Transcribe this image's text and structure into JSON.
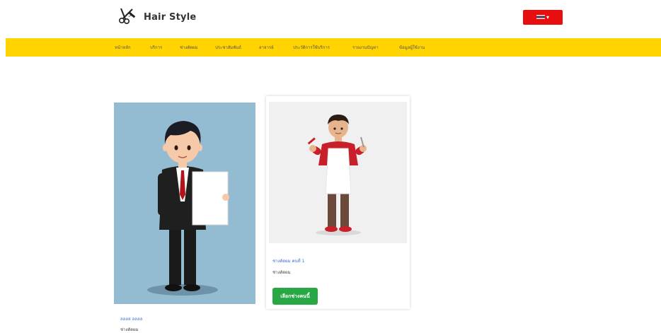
{
  "header": {
    "brand": "Hair Style",
    "logo_icon": "scissors-comb-icon",
    "lang_icon": "thai-flag-icon",
    "lang_color": "#e60e0e"
  },
  "nav": {
    "background": "#ffd400",
    "items": [
      {
        "label": "หน้าหลัก"
      },
      {
        "label": "บริการ"
      },
      {
        "label": "ช่างตัดผม"
      },
      {
        "label": "ประชาสัมพันธ์"
      },
      {
        "label": "อาจารย์"
      },
      {
        "label": "ประวัติการใช้บริการ"
      },
      {
        "label": "รายงานปัญหา"
      },
      {
        "label": "ข้อมูลผู้ใช้งาน"
      }
    ]
  },
  "cards": [
    {
      "name": "ลลลล ลลลล",
      "role": "ช่างตัดผม"
    },
    {
      "name": "ช่างตัดผม คนที่ 1",
      "role": "ช่างตัดผม",
      "button": "เลือกช่างคนนี้"
    }
  ],
  "colors": {
    "primary_button": "#28a745",
    "link": "#3a6fd8"
  }
}
